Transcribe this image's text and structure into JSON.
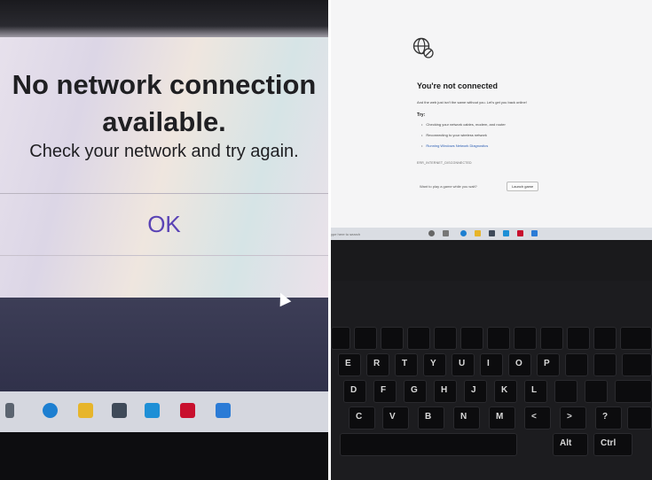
{
  "left_photo": {
    "dialog": {
      "title_line1": "No network connection",
      "title_line2": "available.",
      "subtitle": "Check your network and try again.",
      "ok_button": "OK"
    },
    "taskbar_icons": [
      "task-view-icon",
      "edge-icon",
      "file-explorer-icon",
      "store-icon",
      "app-l-icon",
      "mcafee-icon",
      "mail-icon"
    ]
  },
  "right_photo": {
    "error_page": {
      "title": "You're not connected",
      "subtitle": "And the web just isn't the same without you. Let's get you back online!",
      "try_label": "Try:",
      "suggestions": [
        "Checking your network cables, modem, and router",
        "Reconnecting to your wireless network",
        "Running Windows Network Diagnostics"
      ],
      "error_code": "ERR_INTERNET_DISCONNECTED",
      "game_prompt": "Want to play a game while you wait?",
      "launch_button": "Launch game"
    },
    "taskbar_search": "ype here to search",
    "keyboard_keys": [
      "E",
      "R",
      "T",
      "Y",
      "U",
      "I",
      "O",
      "P",
      "D",
      "F",
      "G",
      "H",
      "J",
      "K",
      "L",
      "C",
      "V",
      "B",
      "N",
      "M",
      "<",
      ">",
      "?",
      "Alt",
      "Ctrl"
    ]
  },
  "colors": {
    "ok_accent": "#5a43b5",
    "link": "#2a5db3",
    "mcafee_red": "#c8102e"
  }
}
